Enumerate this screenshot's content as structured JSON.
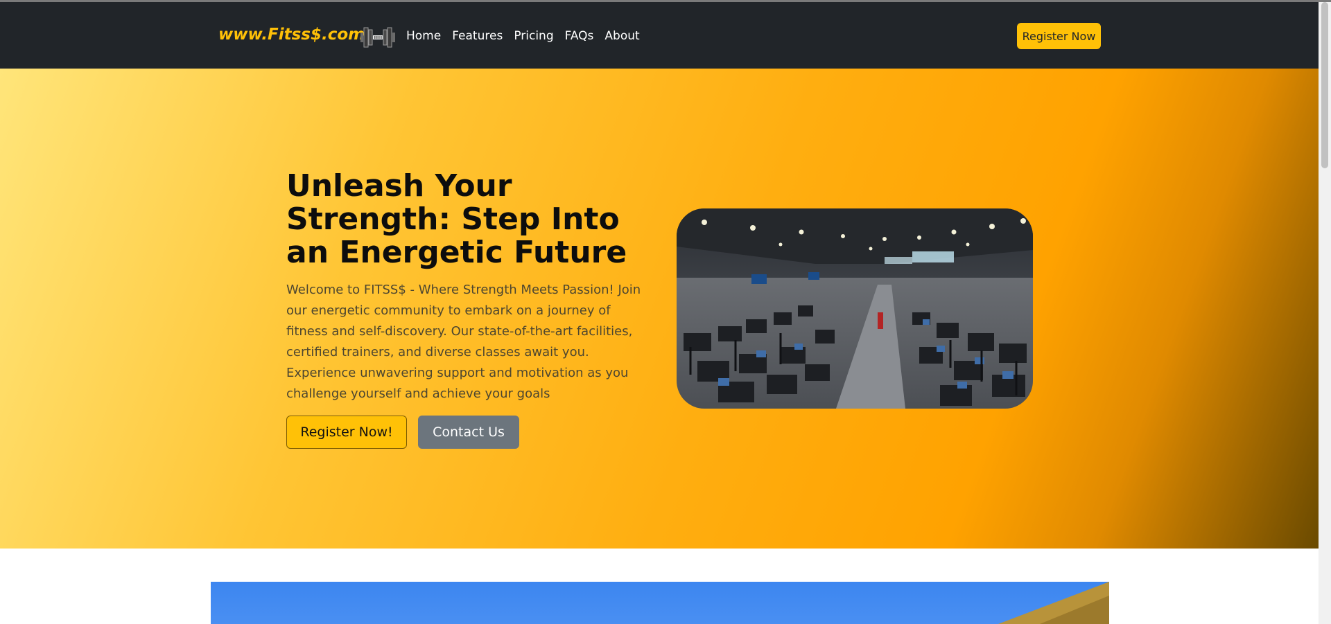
{
  "navbar": {
    "brand": "www.Fitss$.com",
    "logo_icon": "dumbbell-icon",
    "links": [
      "Home",
      "Features",
      "Pricing",
      "FAQs",
      "About"
    ],
    "register_label": "Register Now",
    "background_color": "#212529",
    "accent_color": "#ffc107"
  },
  "hero": {
    "title": "Unleash Your Strength: Step Into an Energetic Future",
    "description": "Welcome to FITSS$ - Where Strength Meets Passion! Join our energetic community to embark on a journey of fitness and self-discovery. Our state-of-the-art facilities, certified trainers, and diverse classes await you. Experience unwavering support and motivation as you challenge yourself and achieve your goals",
    "primary_button": "Register Now!",
    "secondary_button": "Contact Us",
    "image_subject": "gym floor with training machines"
  }
}
